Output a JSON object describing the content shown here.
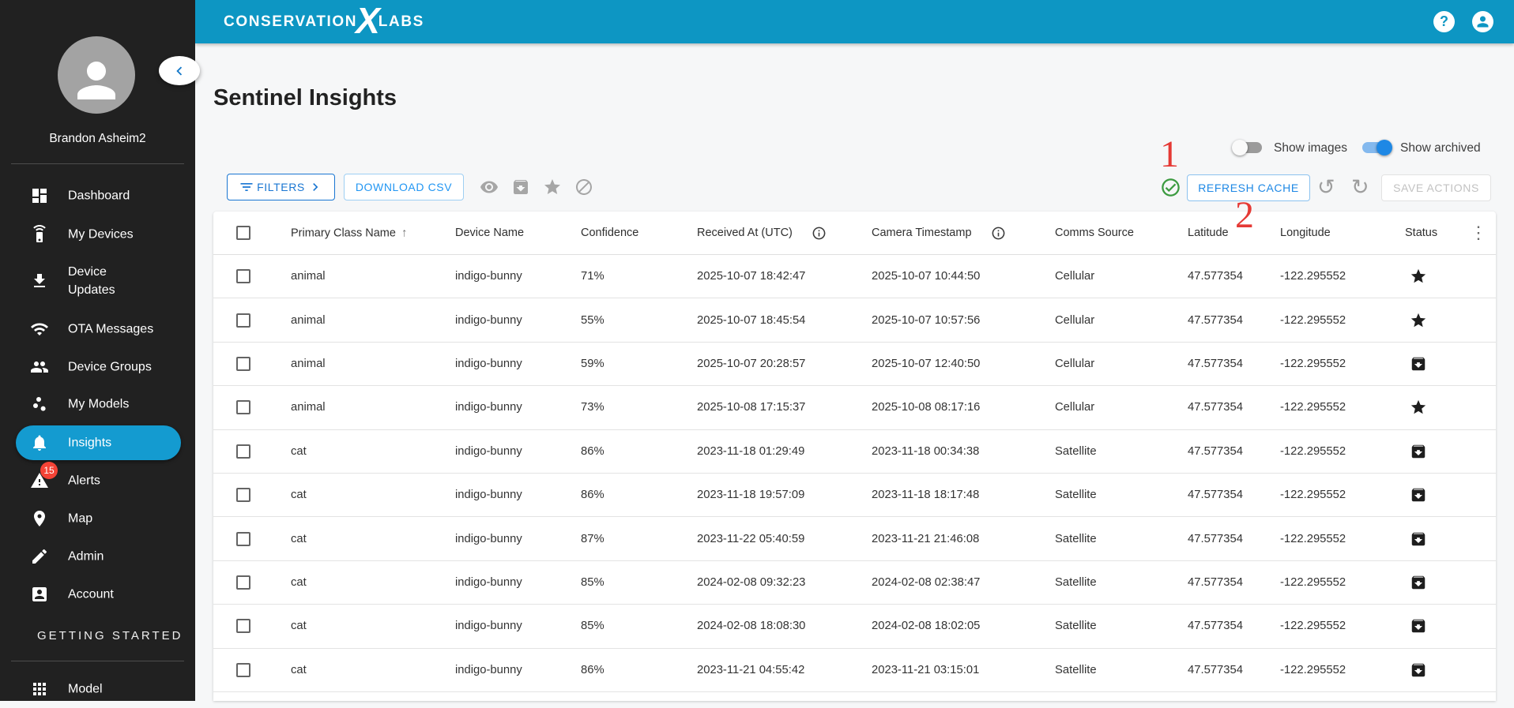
{
  "annotations": {
    "step_1": "1",
    "step_2": "2"
  },
  "topbar": {
    "logo": {
      "text_left": "CONSERVATION",
      "text_x": "X",
      "text_right": "LABS"
    },
    "help_glyph": "?"
  },
  "sidebar": {
    "user_name": "Brandon Asheim2",
    "items": [
      {
        "label": "Dashboard"
      },
      {
        "label": "My Devices"
      },
      {
        "label": "Device Updates"
      },
      {
        "label": "OTA Messages"
      },
      {
        "label": "Device Groups"
      },
      {
        "label": "My Models"
      },
      {
        "label": "Insights",
        "active": true
      },
      {
        "label": "Alerts",
        "badge": "15"
      },
      {
        "label": "Map"
      },
      {
        "label": "Admin"
      },
      {
        "label": "Account"
      }
    ],
    "section_heading": "GETTING STARTED",
    "extra_items": [
      {
        "label": "Model"
      }
    ]
  },
  "main": {
    "title": "Sentinel Insights",
    "toggles": [
      {
        "label": "Show images",
        "on": false
      },
      {
        "label": "Show archived",
        "on": true
      }
    ],
    "toolbar": {
      "filters_label": "FILTERS",
      "download_csv_label": "DOWNLOAD CSV",
      "refresh_cache_label": "REFRESH CACHE",
      "save_actions_label": "SAVE ACTIONS"
    },
    "table": {
      "columns": [
        "Primary Class Name",
        "Device Name",
        "Confidence",
        "Received At (UTC)",
        "Camera Timestamp",
        "Comms Source",
        "Latitude",
        "Longitude",
        "Status"
      ],
      "sorted_by": "Primary Class Name",
      "sort_direction": "asc",
      "rows": [
        {
          "primary_class": "animal",
          "device_name": "indigo-bunny",
          "confidence": "71%",
          "received_at": "2025-10-07 18:42:47",
          "camera_timestamp": "2025-10-07 10:44:50",
          "comms_source": "Cellular",
          "latitude": "47.577354",
          "longitude": "-122.295552",
          "status": "starred"
        },
        {
          "primary_class": "animal",
          "device_name": "indigo-bunny",
          "confidence": "55%",
          "received_at": "2025-10-07 18:45:54",
          "camera_timestamp": "2025-10-07 10:57:56",
          "comms_source": "Cellular",
          "latitude": "47.577354",
          "longitude": "-122.295552",
          "status": "starred"
        },
        {
          "primary_class": "animal",
          "device_name": "indigo-bunny",
          "confidence": "59%",
          "received_at": "2025-10-07 20:28:57",
          "camera_timestamp": "2025-10-07 12:40:50",
          "comms_source": "Cellular",
          "latitude": "47.577354",
          "longitude": "-122.295552",
          "status": "archived"
        },
        {
          "primary_class": "animal",
          "device_name": "indigo-bunny",
          "confidence": "73%",
          "received_at": "2025-10-08 17:15:37",
          "camera_timestamp": "2025-10-08 08:17:16",
          "comms_source": "Cellular",
          "latitude": "47.577354",
          "longitude": "-122.295552",
          "status": "starred"
        },
        {
          "primary_class": "cat",
          "device_name": "indigo-bunny",
          "confidence": "86%",
          "received_at": "2023-11-18 01:29:49",
          "camera_timestamp": "2023-11-18 00:34:38",
          "comms_source": "Satellite",
          "latitude": "47.577354",
          "longitude": "-122.295552",
          "status": "archived"
        },
        {
          "primary_class": "cat",
          "device_name": "indigo-bunny",
          "confidence": "86%",
          "received_at": "2023-11-18 19:57:09",
          "camera_timestamp": "2023-11-18 18:17:48",
          "comms_source": "Satellite",
          "latitude": "47.577354",
          "longitude": "-122.295552",
          "status": "archived"
        },
        {
          "primary_class": "cat",
          "device_name": "indigo-bunny",
          "confidence": "87%",
          "received_at": "2023-11-22 05:40:59",
          "camera_timestamp": "2023-11-21 21:46:08",
          "comms_source": "Satellite",
          "latitude": "47.577354",
          "longitude": "-122.295552",
          "status": "archived"
        },
        {
          "primary_class": "cat",
          "device_name": "indigo-bunny",
          "confidence": "85%",
          "received_at": "2024-02-08 09:32:23",
          "camera_timestamp": "2024-02-08 02:38:47",
          "comms_source": "Satellite",
          "latitude": "47.577354",
          "longitude": "-122.295552",
          "status": "archived"
        },
        {
          "primary_class": "cat",
          "device_name": "indigo-bunny",
          "confidence": "85%",
          "received_at": "2024-02-08 18:08:30",
          "camera_timestamp": "2024-02-08 18:02:05",
          "comms_source": "Satellite",
          "latitude": "47.577354",
          "longitude": "-122.295552",
          "status": "archived"
        },
        {
          "primary_class": "cat",
          "device_name": "indigo-bunny",
          "confidence": "86%",
          "received_at": "2023-11-21 04:55:42",
          "camera_timestamp": "2023-11-21 03:15:01",
          "comms_source": "Satellite",
          "latitude": "47.577354",
          "longitude": "-122.295552",
          "status": "archived"
        }
      ]
    }
  }
}
